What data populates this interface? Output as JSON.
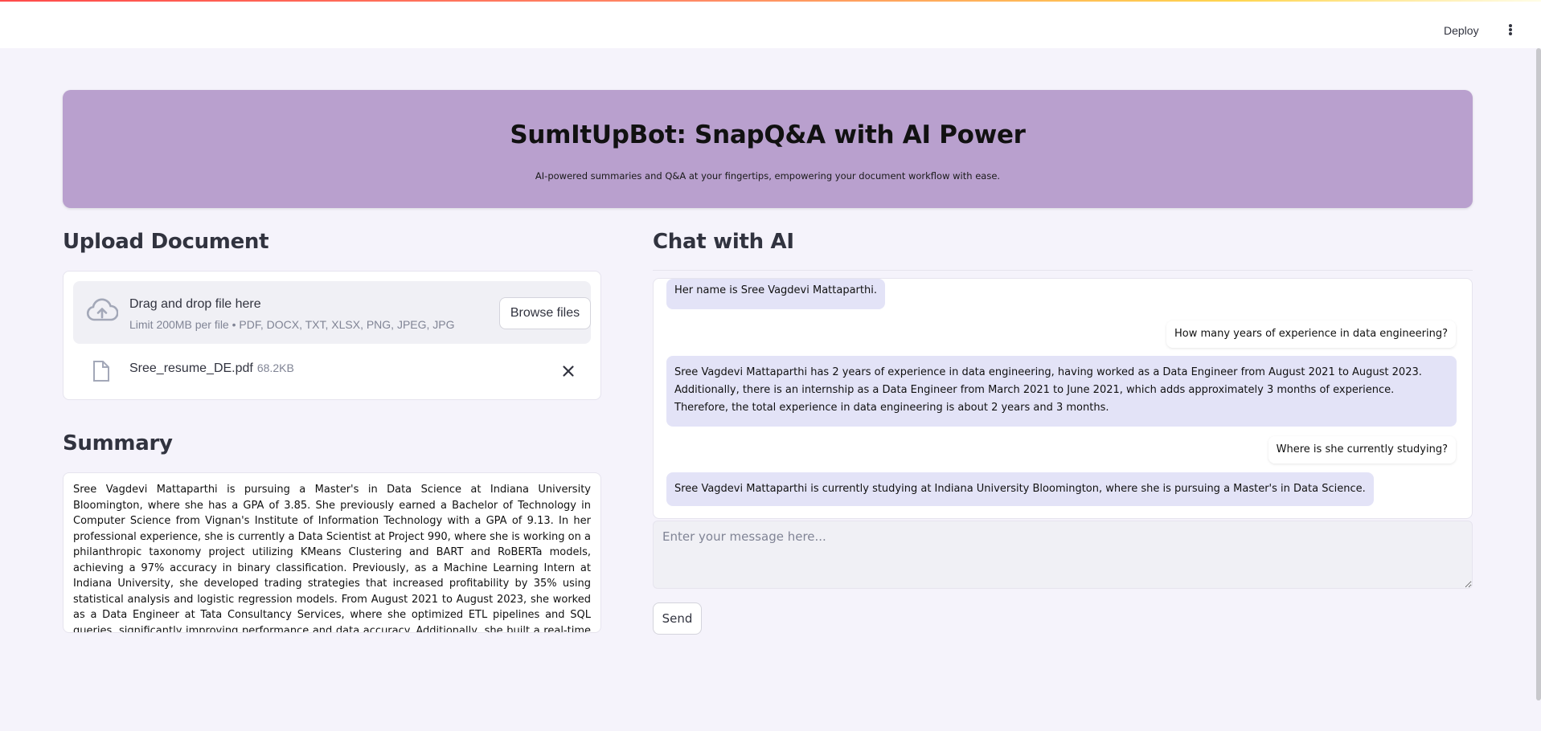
{
  "header": {
    "deploy_label": "Deploy",
    "menu_icon": "kebab-menu-icon"
  },
  "banner": {
    "title": "SumItUpBot: SnapQ&A with AI Power",
    "subtitle": "AI-powered summaries and Q&A at your fingertips, empowering your document workflow with ease."
  },
  "upload": {
    "heading": "Upload Document",
    "drop_title": "Drag and drop file here",
    "drop_limit": "Limit 200MB per file • PDF, DOCX, TXT, XLSX, PNG, JPEG, JPG",
    "browse_label": "Browse files",
    "cloud_icon": "cloud-upload-icon",
    "file": {
      "name": "Sree_resume_DE.pdf",
      "size": "68.2KB",
      "icon": "file-icon",
      "remove_icon": "close-icon"
    }
  },
  "summary": {
    "heading": "Summary",
    "text": "Sree Vagdevi Mattaparthi is pursuing a Master's in Data Science at Indiana University Bloomington, where she has a GPA of 3.85. She previously earned a Bachelor of Technology in Computer Science from Vignan's Institute of Information Technology with a GPA of 9.13. In her professional experience, she is currently a Data Scientist at Project 990, where she is working on a philanthropic taxonomy project utilizing KMeans Clustering and BART and RoBERTa models, achieving a 97% accuracy in binary classification. Previously, as a Machine Learning Intern at Indiana University, she developed trading strategies that increased profitability by 35% using statistical analysis and logistic regression models. From August 2021 to August 2023, she worked as a Data Engineer at Tata Consultancy Services, where she optimized ETL pipelines and SQL queries, significantly improving performance and data accuracy. Additionally, she built a real-time data pipeline as a Data Engineer Intern, enhancing supply chain analytics and reducing data latency by 45%. Her technical skills include"
  },
  "chat": {
    "heading": "Chat with AI",
    "messages": [
      {
        "role": "bot",
        "text": "Her name is Sree Vagdevi Mattaparthi."
      },
      {
        "role": "user",
        "text": "How many years of experience in data engineering?"
      },
      {
        "role": "bot",
        "text": "Sree Vagdevi Mattaparthi has 2 years of experience in data engineering, having worked as a Data Engineer from August 2021 to August 2023. Additionally, there is an internship as a Data Engineer from March 2021 to June 2021, which adds approximately 3 months of experience. Therefore, the total experience in data engineering is about 2 years and 3 months."
      },
      {
        "role": "user",
        "text": "Where is she currently studying?"
      },
      {
        "role": "bot",
        "text": "Sree Vagdevi Mattaparthi is currently studying at Indiana University Bloomington, where she is pursuing a Master's in Data Science."
      }
    ],
    "input_placeholder": "Enter your message here...",
    "input_value": "",
    "send_label": "Send"
  },
  "colors": {
    "banner_bg": "#b9a0ce",
    "page_bg": "#f5f3fb",
    "bot_bubble": "#e3e3f7"
  }
}
